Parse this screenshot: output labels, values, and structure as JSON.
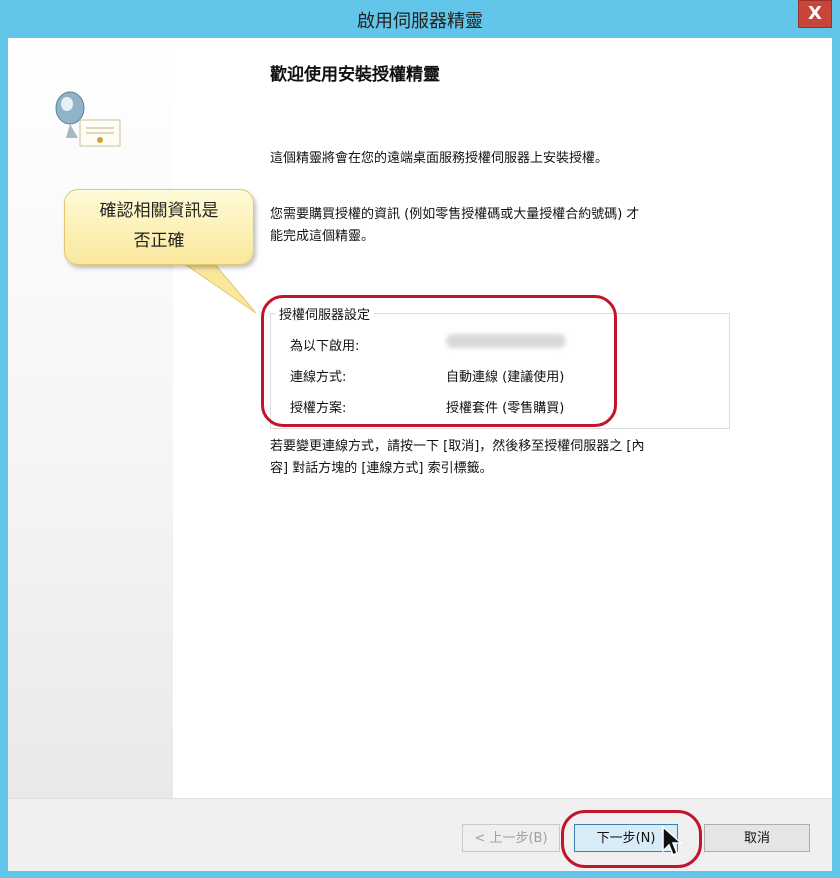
{
  "window": {
    "title": "啟用伺服器精靈",
    "close_label": "X"
  },
  "wizard": {
    "heading": "歡迎使用安裝授權精靈",
    "paragraph1": "這個精靈將會在您的遠端桌面服務授權伺服器上安裝授權。",
    "paragraph2_line1": "您需要購買授權的資訊 (例如零售授權碼或大量授權合約號碼) 才",
    "paragraph2_line2": "能完成這個精靈。",
    "settings_group": {
      "title": "授權伺服器設定",
      "rows": [
        {
          "label": "為以下啟用:",
          "value": ""
        },
        {
          "label": "連線方式:",
          "value": "自動連線 (建議使用)"
        },
        {
          "label": "授權方案:",
          "value": "授權套件 (零售購買)"
        }
      ]
    },
    "paragraph3_line1": "若要變更連線方式，請按一下 [取消]，然後移至授權伺服器之 [內",
    "paragraph3_line2": "容] 對話方塊的 [連線方式] 索引標籤。"
  },
  "callout": {
    "line1": "確認相關資訊是",
    "line2": "否正確"
  },
  "buttons": {
    "back": "< 上一步(B)",
    "next": "下一步(N)",
    "cancel": "取消"
  },
  "colors": {
    "title_bar": "#62c6ea",
    "close_button": "#c8453b",
    "annotation": "#c0152a",
    "callout_fill": "#fbeeb0"
  },
  "icons": [
    "license-server-icon",
    "close-icon",
    "mouse-cursor-icon"
  ]
}
